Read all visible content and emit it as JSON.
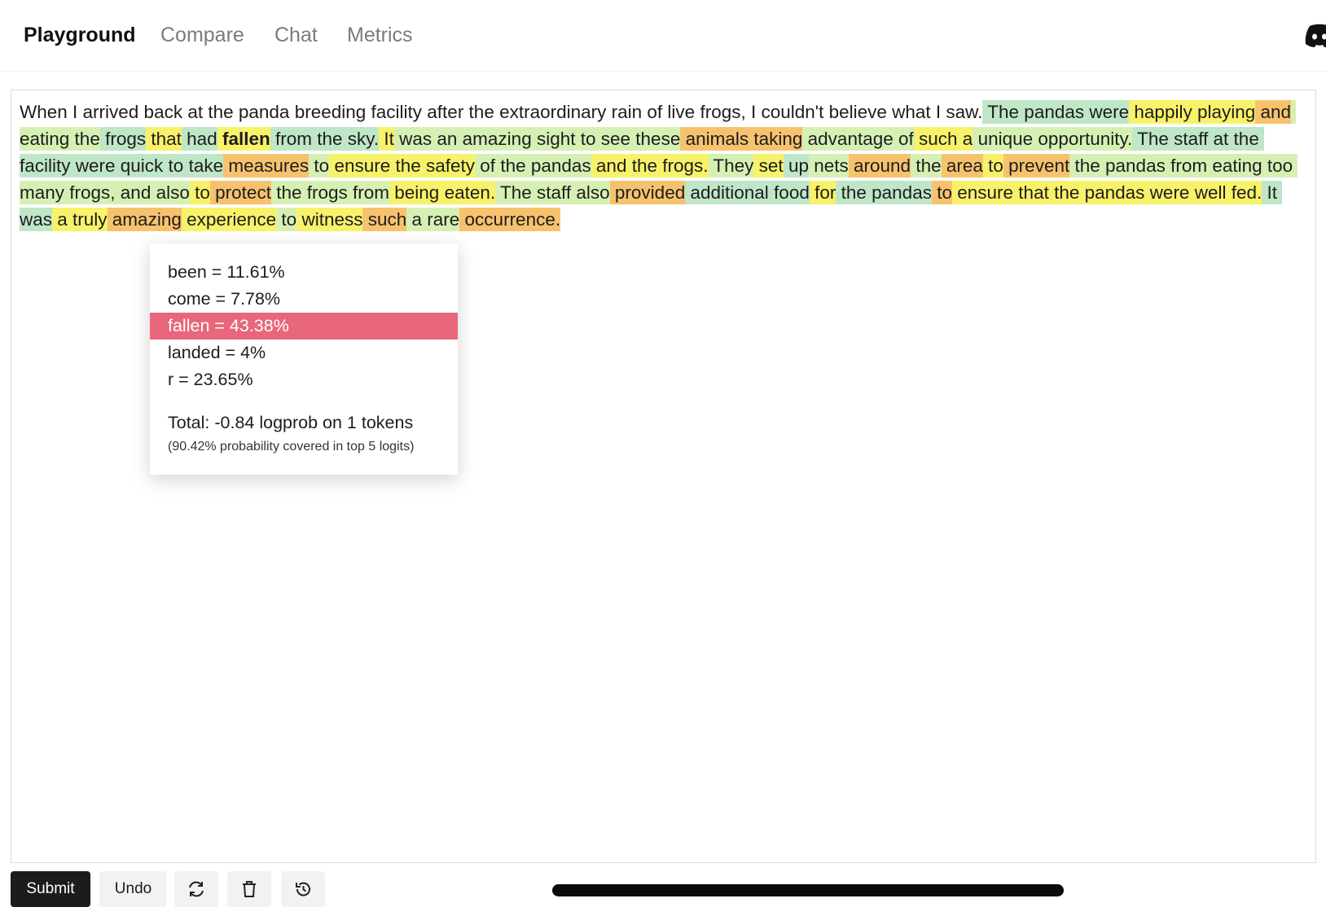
{
  "nav": {
    "tabs": [
      {
        "label": "Playground",
        "active": true
      },
      {
        "label": "Compare",
        "active": false
      },
      {
        "label": "Chat",
        "active": false
      },
      {
        "label": "Metrics",
        "active": false
      }
    ],
    "discord_icon": "discord-icon"
  },
  "colors": {
    "green": "#bfe6c7",
    "lightgreen": "#d6f0b4",
    "yellow": "#f8f26a",
    "orange": "#f7c26e",
    "popup_highlight": "#e8677a",
    "primary_button": "#1c1c1c"
  },
  "editor": {
    "tokens": [
      {
        "t": "When I arrived back at the panda breeding facility after the extraordinary rain of live frogs, I couldn't believe what I saw.",
        "c": "none"
      },
      {
        "t": " The pandas were",
        "c": "green"
      },
      {
        "t": " happily playing",
        "c": "yellow"
      },
      {
        "t": " and",
        "c": "orange"
      },
      {
        "t": " eating the",
        "c": "lightgreen"
      },
      {
        "t": " frogs",
        "c": "green"
      },
      {
        "t": " that",
        "c": "yellow"
      },
      {
        "t": " had",
        "c": "green"
      },
      {
        "t": " fallen",
        "c": "yellow",
        "selected": true
      },
      {
        "t": " from the sky.",
        "c": "green"
      },
      {
        "t": " It",
        "c": "yellow"
      },
      {
        "t": " was an amazing sight to see these",
        "c": "lightgreen"
      },
      {
        "t": " animals taking",
        "c": "orange"
      },
      {
        "t": " advantage of",
        "c": "lightgreen"
      },
      {
        "t": " such a",
        "c": "yellow"
      },
      {
        "t": " unique opportunity.",
        "c": "lightgreen"
      },
      {
        "t": " The staff at the facility were quick to take",
        "c": "green"
      },
      {
        "t": " measures",
        "c": "orange"
      },
      {
        "t": " to",
        "c": "lightgreen"
      },
      {
        "t": " ensure the safety",
        "c": "yellow"
      },
      {
        "t": " of the pandas",
        "c": "lightgreen"
      },
      {
        "t": " and the frogs.",
        "c": "yellow"
      },
      {
        "t": " They",
        "c": "lightgreen"
      },
      {
        "t": " set",
        "c": "yellow"
      },
      {
        "t": " up",
        "c": "green"
      },
      {
        "t": " nets",
        "c": "lightgreen"
      },
      {
        "t": " around",
        "c": "orange"
      },
      {
        "t": " the",
        "c": "lightgreen"
      },
      {
        "t": " area",
        "c": "orange"
      },
      {
        "t": " to",
        "c": "yellow"
      },
      {
        "t": " prevent",
        "c": "orange"
      },
      {
        "t": " the pandas from eating too many frogs, and also",
        "c": "lightgreen"
      },
      {
        "t": " to",
        "c": "yellow"
      },
      {
        "t": " protect",
        "c": "orange"
      },
      {
        "t": " the frogs from",
        "c": "lightgreen"
      },
      {
        "t": " being eaten.",
        "c": "yellow"
      },
      {
        "t": " The staff also",
        "c": "lightgreen"
      },
      {
        "t": " provided",
        "c": "orange"
      },
      {
        "t": " additional food",
        "c": "green"
      },
      {
        "t": " for",
        "c": "yellow"
      },
      {
        "t": " the pandas",
        "c": "green"
      },
      {
        "t": " to",
        "c": "orange"
      },
      {
        "t": " ensure that the pandas were well fed.",
        "c": "yellow"
      },
      {
        "t": " It was",
        "c": "green"
      },
      {
        "t": " a truly",
        "c": "yellow"
      },
      {
        "t": " amazing",
        "c": "orange"
      },
      {
        "t": " experience",
        "c": "yellow"
      },
      {
        "t": " to",
        "c": "lightgreen"
      },
      {
        "t": " witness",
        "c": "yellow"
      },
      {
        "t": " such",
        "c": "orange"
      },
      {
        "t": " a rare",
        "c": "lightgreen"
      },
      {
        "t": " occurrence.",
        "c": "orange"
      }
    ]
  },
  "popup": {
    "logits": [
      {
        "label": "been = 11.61%",
        "highlighted": false
      },
      {
        "label": "come = 7.78%",
        "highlighted": false
      },
      {
        "label": "fallen = 43.38%",
        "highlighted": true
      },
      {
        "label": "landed = 4%",
        "highlighted": false
      },
      {
        "label": "r = 23.65%",
        "highlighted": false
      }
    ],
    "total": "Total: -0.84 logprob on 1 tokens",
    "coverage": "(90.42% probability covered in top 5 logits)"
  },
  "toolbar": {
    "submit_label": "Submit",
    "undo_label": "Undo",
    "regenerate_icon": "refresh-icon",
    "delete_icon": "trash-icon",
    "history_icon": "history-icon"
  }
}
